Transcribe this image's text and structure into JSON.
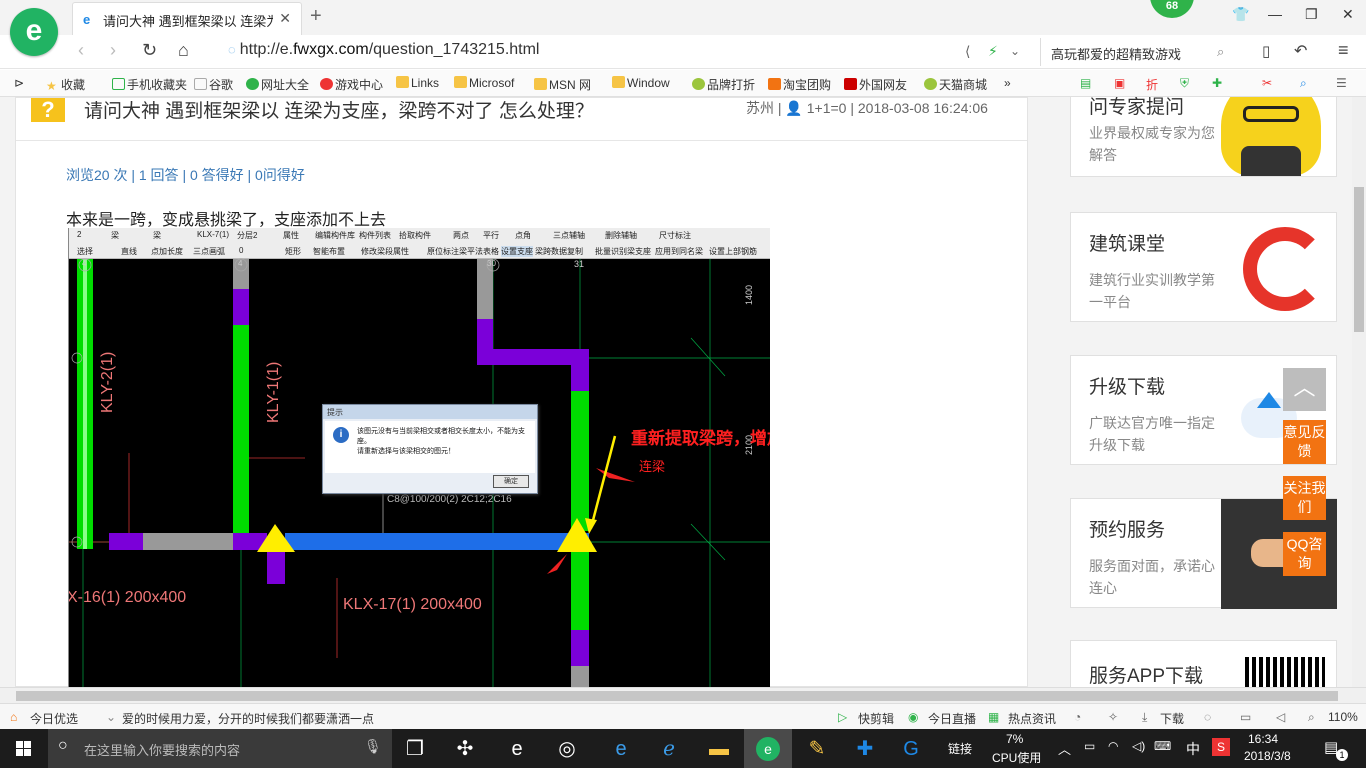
{
  "browser": {
    "logo_letter": "e",
    "tab_title": "请问大神 遇到框架梁以 连梁为支",
    "badge_count": "68",
    "url_prefix": "http://e.",
    "url_host": "fwxgx.com",
    "url_path": "/question_1743215.html",
    "search_text": "高玩都爱的超精致游戏"
  },
  "bookmarks": [
    "收藏",
    "手机收藏夹",
    "谷歌",
    "网址大全",
    "游戏中心",
    "Links",
    "Microsof",
    "MSN 网",
    "Window",
    "品牌打折",
    "淘宝团购",
    "外国网友",
    "天猫商城"
  ],
  "question": {
    "icon": "?",
    "title": "请问大神 遇到框架梁以 连梁为支座，梁跨不对了 怎么处理？",
    "location": "苏州",
    "user": "1+1=0",
    "datetime": "2018-03-08 16:24:06",
    "stats": "浏览20 次 | 1 回答 | 0 答得好 | 0问得好",
    "body": "本来是一跨，变成悬挑梁了，支座添加不上去"
  },
  "shot": {
    "toolbar_row1": [
      "2",
      "梁",
      "梁",
      "KLX-7(1)",
      "分层2",
      "属性",
      "编辑构件库",
      "构件列表",
      "拾取构件",
      "两点",
      "平行",
      "点角",
      "三点辅轴",
      "删除辅轴",
      "尺寸标注"
    ],
    "toolbar_row2": [
      "选择",
      "直线",
      "点加长度",
      "三点画弧",
      "0",
      "矩形",
      "智能布置",
      "修改梁段属性",
      "原位标注",
      "梁平法表格",
      "设置支座",
      "梁跨数据复制",
      "批量识别梁支座",
      "应用到同名梁",
      "设置上部钢筋"
    ],
    "axis_labels": [
      "4",
      "4",
      "30",
      "31"
    ],
    "dim_labels": [
      "1400",
      "2100"
    ],
    "beam_labels": [
      "KLY-2(1)",
      "KLY-1(1)",
      "X-16(1) 200x400",
      "KLX-17(1) 200x400"
    ],
    "rebar_label": "C8@100/200(2) 2C12;2C16",
    "annotation_main": "重新提取梁跨，增加支座",
    "annotation_sub": "连梁",
    "dialog_title": "提示",
    "dialog_line1": "该图元没有与当前梁相交或者相交长度太小，不能为支座。",
    "dialog_line2": "请重新选择与该梁相交的图元！",
    "dialog_ok": "确定"
  },
  "sidebar": [
    {
      "title": "问专家提问",
      "desc": "业界最权威专家为您解答"
    },
    {
      "title": "建筑课堂",
      "desc": "建筑行业实训教学第一平台"
    },
    {
      "title": "升级下载",
      "desc": "广联达官方唯一指定升级下载"
    },
    {
      "title": "预约服务",
      "desc": "服务面对面，承诺心连心"
    },
    {
      "title": "服务APP下载",
      "desc": ""
    }
  ],
  "float_buttons": [
    "意见反馈",
    "关注我们",
    "QQ咨询"
  ],
  "statusbar": {
    "left": "今日优选",
    "news": "爱的时候用力爱，分开的时候我们都要潇洒一点",
    "items": [
      "快剪辑",
      "今日直播",
      "热点资讯",
      "下载"
    ],
    "zoom": "110%"
  },
  "taskbar": {
    "search_placeholder": "在这里输入你要搜索的内容",
    "links": "链接",
    "cpu_percent": "7%",
    "cpu_label": "CPU使用",
    "ime": "中",
    "time": "16:34",
    "date": "2018/3/8",
    "notif_count": "1"
  },
  "colors": {
    "accent_green": "#21b363",
    "orange": "#f27312",
    "link_blue": "#3a78b5"
  }
}
